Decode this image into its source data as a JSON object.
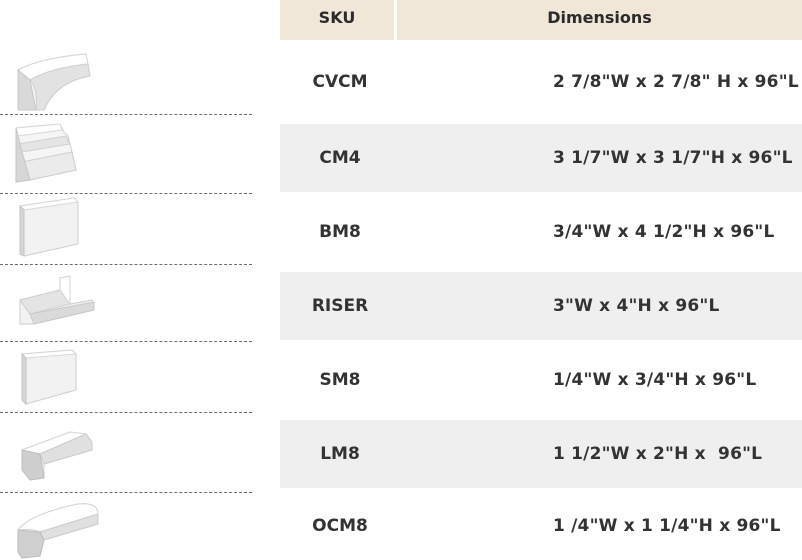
{
  "header": {
    "sku_label": "SKU",
    "dimensions_label": "Dimensions"
  },
  "rows": [
    {
      "sku": "CVCM",
      "dimensions": "2 7/8\"W x 2 7/8\" H x 96\"L",
      "icon": "crown-molding-icon"
    },
    {
      "sku": "CM4",
      "dimensions": "3 1/7\"W x 3 1/7\"H x 96\"L",
      "icon": "crown-molding-4-icon"
    },
    {
      "sku": "BM8",
      "dimensions": "3/4\"W x 4 1/2\"H x 96\"L",
      "icon": "base-molding-icon"
    },
    {
      "sku": "RISER",
      "dimensions": "3\"W x 4\"H x 96\"L",
      "icon": "riser-icon"
    },
    {
      "sku": "SM8",
      "dimensions": "1/4\"W x 3/4\"H x 96\"L",
      "icon": "scribe-molding-icon"
    },
    {
      "sku": "LM8",
      "dimensions": "1 1/2\"W x 2\"H x  96\"L",
      "icon": "light-rail-molding-icon"
    },
    {
      "sku": "OCM8",
      "dimensions": "1 /4\"W x 1 1/4\"H x 96\"L",
      "icon": "outside-corner-molding-icon"
    }
  ]
}
